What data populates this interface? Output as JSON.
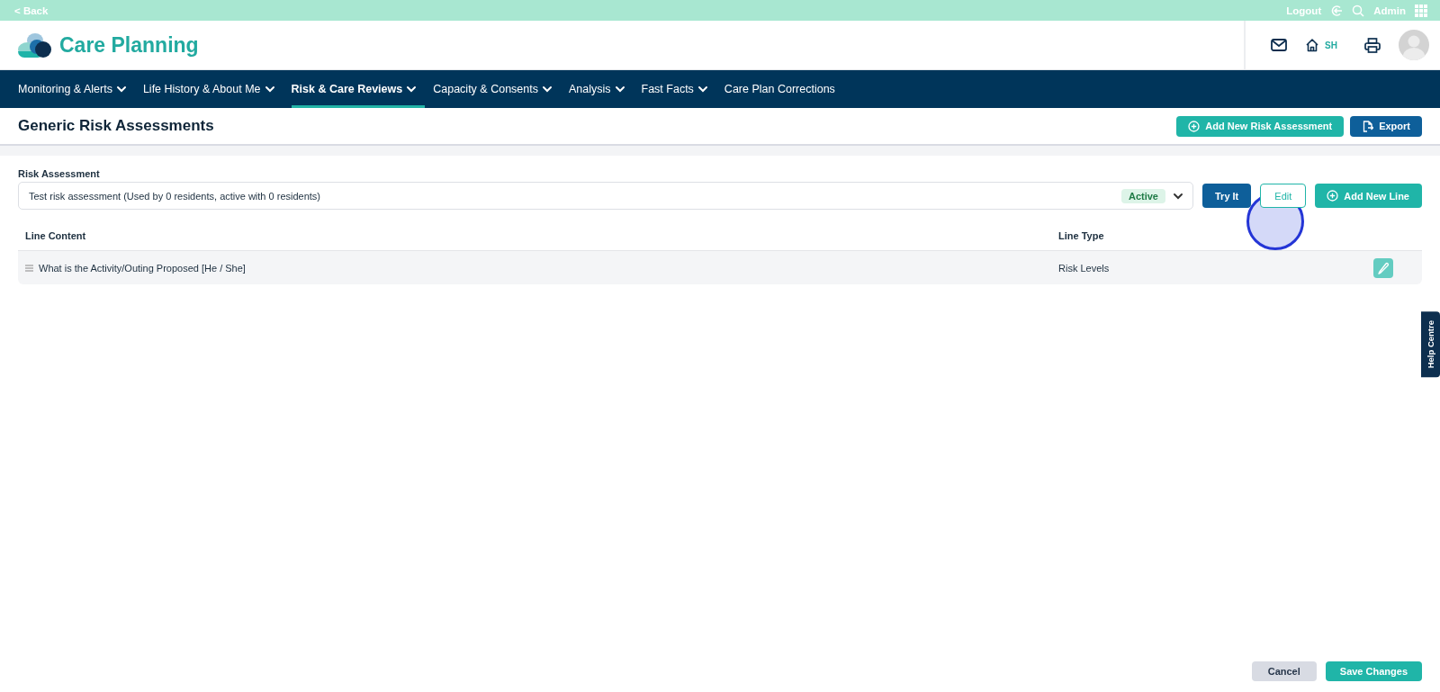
{
  "top_bar": {
    "back": "< Back",
    "logout": "Logout",
    "user": "Admin"
  },
  "header": {
    "app_name": "Care Planning",
    "home_code": "SH"
  },
  "nav": [
    {
      "label": "Monitoring & Alerts",
      "dropdown": true,
      "selected": false
    },
    {
      "label": "Life History & About Me",
      "dropdown": true,
      "selected": false
    },
    {
      "label": "Risk & Care Reviews",
      "dropdown": true,
      "selected": true
    },
    {
      "label": "Capacity & Consents",
      "dropdown": true,
      "selected": false
    },
    {
      "label": "Analysis",
      "dropdown": true,
      "selected": false
    },
    {
      "label": "Fast Facts",
      "dropdown": true,
      "selected": false
    },
    {
      "label": "Care Plan Corrections",
      "dropdown": false,
      "selected": false
    }
  ],
  "page": {
    "title": "Generic Risk Assessments",
    "actions": [
      {
        "kind": "add",
        "label": "Add New Risk Assessment"
      },
      {
        "kind": "export",
        "label": "Export"
      }
    ]
  },
  "form": {
    "label": "Risk Assessment",
    "select": {
      "value": "Test risk assessment (Used by 0 residents, active with 0 residents)",
      "status": "Active"
    },
    "buttons": [
      {
        "kind": "try",
        "label": "Try It"
      },
      {
        "kind": "edit",
        "label": "Edit"
      },
      {
        "kind": "add",
        "label": "Add New Line"
      }
    ]
  },
  "table": {
    "columns": [
      "Line Content",
      "Line Type"
    ],
    "rows": [
      {
        "content": "What is the Activity/Outing Proposed [He / She]",
        "type": "Risk Levels"
      }
    ]
  },
  "help_tab": "Help Centre",
  "footer": {
    "buttons": [
      {
        "kind": "cancel",
        "label": "Cancel"
      },
      {
        "kind": "save",
        "label": "Save Changes"
      }
    ]
  }
}
